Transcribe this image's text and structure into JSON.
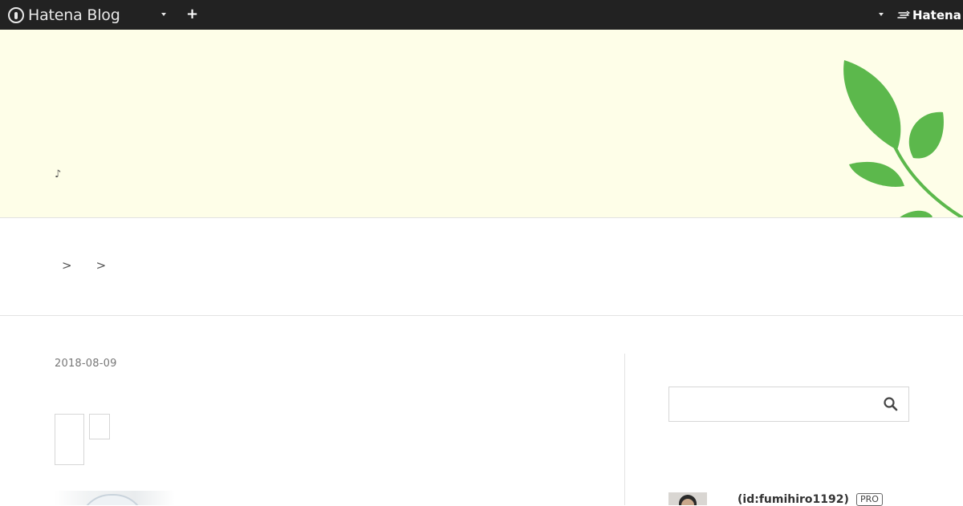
{
  "topbar": {
    "brand": "Hatena Blog",
    "add_icon": "plus-icon",
    "menu_icon": "caret-down-icon",
    "hatena_label": "Hatena"
  },
  "header": {
    "title_lines": [
      "",
      "",
      "",
      ""
    ],
    "description": "♪"
  },
  "breadcrumb": {
    "separators": [
      ">",
      ">"
    ]
  },
  "entry": {
    "date": "2018-08-09",
    "title": ""
  },
  "sidebar": {
    "search": {
      "placeholder": "",
      "icon": "search-icon"
    },
    "profile": {
      "user_id": "(id:fumihiro1192)",
      "badge": "PRO"
    }
  },
  "colors": {
    "topbar_bg": "#222222",
    "header_bg": "#fefee8",
    "leaf_green": "#5cb84c",
    "divider": "#e2e2e2"
  }
}
